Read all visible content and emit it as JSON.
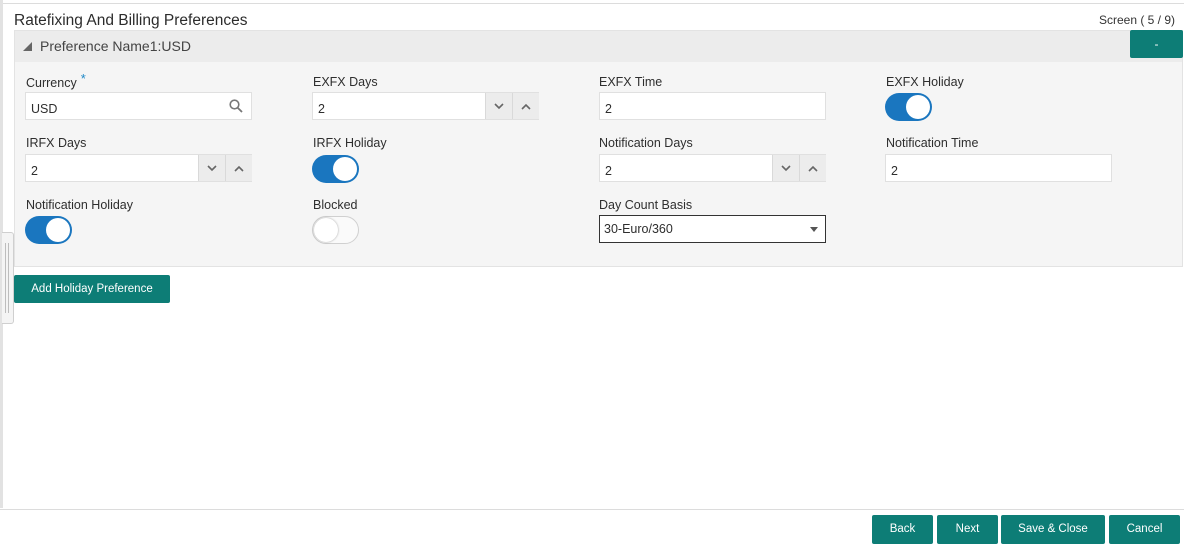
{
  "page": {
    "title": "Ratefixing And Billing Preferences",
    "screen_indicator": "Screen ( 5 / 9)"
  },
  "panel": {
    "title": "Preference Name1:USD",
    "collapse_button_label": "-"
  },
  "fields": {
    "currency": {
      "label": "Currency",
      "required_mark": "*",
      "value": "USD"
    },
    "exfx_days": {
      "label": "EXFX Days",
      "value": "2"
    },
    "exfx_time": {
      "label": "EXFX Time",
      "value": "2"
    },
    "exfx_holiday": {
      "label": "EXFX Holiday",
      "on": true
    },
    "irfx_days": {
      "label": "IRFX Days",
      "value": "2"
    },
    "irfx_holiday": {
      "label": "IRFX Holiday",
      "on": true
    },
    "notification_days": {
      "label": "Notification Days",
      "value": "2"
    },
    "notification_time": {
      "label": "Notification Time",
      "value": "2"
    },
    "notification_holiday": {
      "label": "Notification Holiday",
      "on": true
    },
    "blocked": {
      "label": "Blocked",
      "on": false
    },
    "day_count_basis": {
      "label": "Day Count Basis",
      "value": "30-Euro/360"
    }
  },
  "actions": {
    "add_holiday_preference": "Add Holiday Preference"
  },
  "footer": {
    "back": "Back",
    "next": "Next",
    "save_close": "Save & Close",
    "cancel": "Cancel"
  },
  "colors": {
    "accent": "#0d7d76",
    "toggle_on": "#1a76bf",
    "required": "#1e88c7"
  },
  "icons": [
    "search-icon",
    "chevron-down-icon",
    "chevron-up-icon",
    "collapse-triangle-icon",
    "dropdown-caret-icon"
  ]
}
